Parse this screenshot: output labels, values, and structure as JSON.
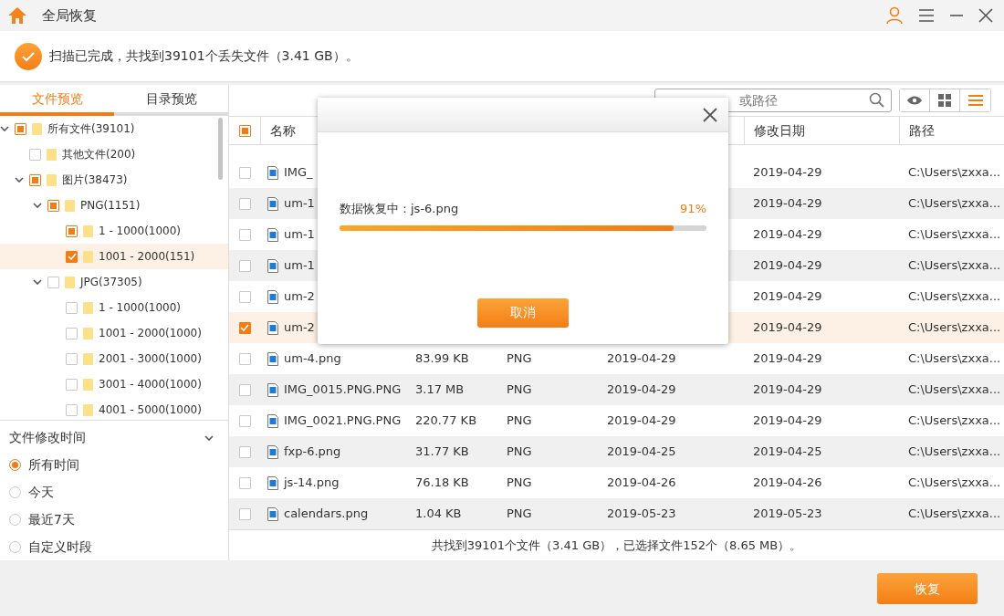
{
  "window": {
    "title": "全局恢复"
  },
  "status": {
    "text": "扫描已完成，共找到39101个丢失文件（3.41 GB）。"
  },
  "left_tabs": [
    {
      "label": "文件预览",
      "selected": true
    },
    {
      "label": "目录预览",
      "selected": false
    }
  ],
  "tree": [
    {
      "label": "所有文件(39101)",
      "checked": false,
      "partial": true,
      "expanded": true,
      "selected": false,
      "children": [
        {
          "label": "其他文件(200)",
          "checked": false,
          "selected": false
        },
        {
          "label": "图片(38473)",
          "checked": false,
          "partial": true,
          "expanded": true,
          "selected": false,
          "children": [
            {
              "label": "PNG(1151)",
              "checked": false,
              "partial": true,
              "expanded": true,
              "selected": false,
              "children": [
                {
                  "label": "1 - 1000(1000)",
                  "checked": false,
                  "partial": true,
                  "selected": false
                },
                {
                  "label": "1001 - 2000(151)",
                  "checked": true,
                  "selected": true
                }
              ]
            },
            {
              "label": "JPG(37305)",
              "checked": false,
              "expanded": true,
              "selected": false,
              "children": [
                {
                  "label": "1 - 1000(1000)",
                  "checked": false,
                  "selected": false
                },
                {
                  "label": "1001 - 2000(1000)",
                  "checked": false,
                  "selected": false
                },
                {
                  "label": "2001 - 3000(1000)",
                  "checked": false,
                  "selected": false
                },
                {
                  "label": "3001 - 4000(1000)",
                  "checked": false,
                  "selected": false
                },
                {
                  "label": "4001 - 5000(1000)",
                  "checked": false,
                  "selected": false
                }
              ]
            }
          ]
        }
      ]
    }
  ],
  "filter": {
    "title": "文件修改时间",
    "options": [
      {
        "label": "所有时间",
        "selected": true
      },
      {
        "label": "今天",
        "selected": false
      },
      {
        "label": "最近7天",
        "selected": false
      },
      {
        "label": "自定义时段",
        "selected": false
      }
    ]
  },
  "search": {
    "placeholder": "或路径"
  },
  "views": [
    {
      "kind": "preview",
      "selected": false
    },
    {
      "kind": "grid",
      "selected": false
    },
    {
      "kind": "list",
      "selected": true
    }
  ],
  "table": {
    "header_check": {
      "checked": false,
      "partial": true
    },
    "columns": [
      {
        "label": "名称"
      },
      {
        "label": "修改日期"
      },
      {
        "label": "路径"
      }
    ],
    "rows": [
      {
        "name": "IMG_",
        "modified": "2019-04-29",
        "path": "C:\\Users\\zxxa...",
        "checked": false
      },
      {
        "name": "um-1",
        "modified": "2019-04-29",
        "path": "C:\\Users\\zxxa...",
        "checked": false
      },
      {
        "name": "um-1",
        "modified": "2019-04-29",
        "path": "C:\\Users\\zxxa...",
        "checked": false
      },
      {
        "name": "um-1",
        "modified": "2019-04-29",
        "path": "C:\\Users\\zxxa...",
        "checked": false
      },
      {
        "name": "um-2",
        "modified": "2019-04-29",
        "path": "C:\\Users\\zxxa...",
        "checked": false
      },
      {
        "name": "um-2",
        "modified": "2019-04-29",
        "path": "C:\\Users\\zxxa...",
        "checked": true
      },
      {
        "name": "um-4.png",
        "size": "83.99 KB",
        "type": "PNG",
        "created": "2019-04-29",
        "modified": "2019-04-29",
        "path": "C:\\Users\\zxxa...",
        "checked": false
      },
      {
        "name": "IMG_0015.PNG.PNG",
        "size": "3.17 MB",
        "type": "PNG",
        "created": "2019-04-29",
        "modified": "2019-04-29",
        "path": "C:\\Users\\zxxa...",
        "checked": false
      },
      {
        "name": "IMG_0021.PNG.PNG",
        "size": "220.77 KB",
        "type": "PNG",
        "created": "2019-04-29",
        "modified": "2019-04-29",
        "path": "C:\\Users\\zxxa...",
        "checked": false
      },
      {
        "name": "fxp-6.png",
        "size": "31.77 KB",
        "type": "PNG",
        "created": "2019-04-25",
        "modified": "2019-04-25",
        "path": "C:\\Users\\zxxa...",
        "checked": false
      },
      {
        "name": "js-14.png",
        "size": "76.18 KB",
        "type": "PNG",
        "created": "2019-04-26",
        "modified": "2019-04-26",
        "path": "C:\\Users\\zxxa...",
        "checked": false
      },
      {
        "name": "calendars.png",
        "size": "1.04 KB",
        "type": "PNG",
        "created": "2019-05-23",
        "modified": "2019-05-23",
        "path": "C:\\Users\\zxxa...",
        "checked": false
      }
    ]
  },
  "summary": "共找到39101个文件（3.41 GB），已选择文件152个（8.65 MB）。",
  "recover_button": "恢复",
  "dialog": {
    "message": "数据恢复中：js-6.png",
    "percent": "91%",
    "level": 0.91,
    "cancel": "取消"
  }
}
